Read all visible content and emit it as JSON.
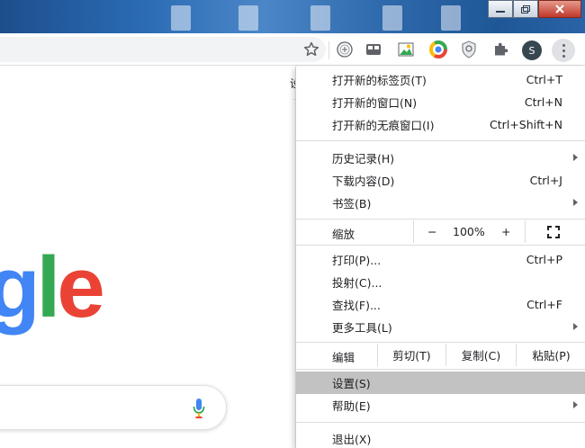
{
  "toolbar": {
    "profile_initial": "S",
    "icon_names": [
      "star-icon",
      "translate-icon",
      "extension-icon",
      "image-icon",
      "color-wheel-icon",
      "shield-icon",
      "puzzle-icon"
    ]
  },
  "page": {
    "peek_text": "设",
    "logo": {
      "g": "g",
      "l": "l",
      "e": "e"
    }
  },
  "menu": {
    "group1": [
      {
        "label": "打开新的标签页(T)",
        "shortcut": "Ctrl+T"
      },
      {
        "label": "打开新的窗口(N)",
        "shortcut": "Ctrl+N"
      },
      {
        "label": "打开新的无痕窗口(I)",
        "shortcut": "Ctrl+Shift+N"
      }
    ],
    "group2": [
      {
        "label": "历史记录(H)",
        "shortcut": ""
      },
      {
        "label": "下载内容(D)",
        "shortcut": "Ctrl+J"
      },
      {
        "label": "书签(B)",
        "shortcut": ""
      }
    ],
    "zoom": {
      "label": "缩放",
      "minus": "−",
      "value": "100%",
      "plus": "+"
    },
    "group3": [
      {
        "label": "打印(P)...",
        "shortcut": "Ctrl+P"
      },
      {
        "label": "投射(C)...",
        "shortcut": ""
      },
      {
        "label": "查找(F)...",
        "shortcut": "Ctrl+F"
      },
      {
        "label": "更多工具(L)",
        "shortcut": ""
      }
    ],
    "edit": {
      "label": "编辑",
      "cut": "剪切(T)",
      "copy": "复制(C)",
      "paste": "粘贴(P)"
    },
    "group4": [
      {
        "label": "设置(S)",
        "shortcut": ""
      },
      {
        "label": "帮助(E)",
        "shortcut": ""
      }
    ],
    "exit": {
      "label": "退出(X)"
    }
  },
  "colors": {
    "menu_highlight": "#c2c2c2",
    "google_blue": "#4285f4",
    "google_green": "#34a853",
    "google_red": "#ea4335"
  }
}
